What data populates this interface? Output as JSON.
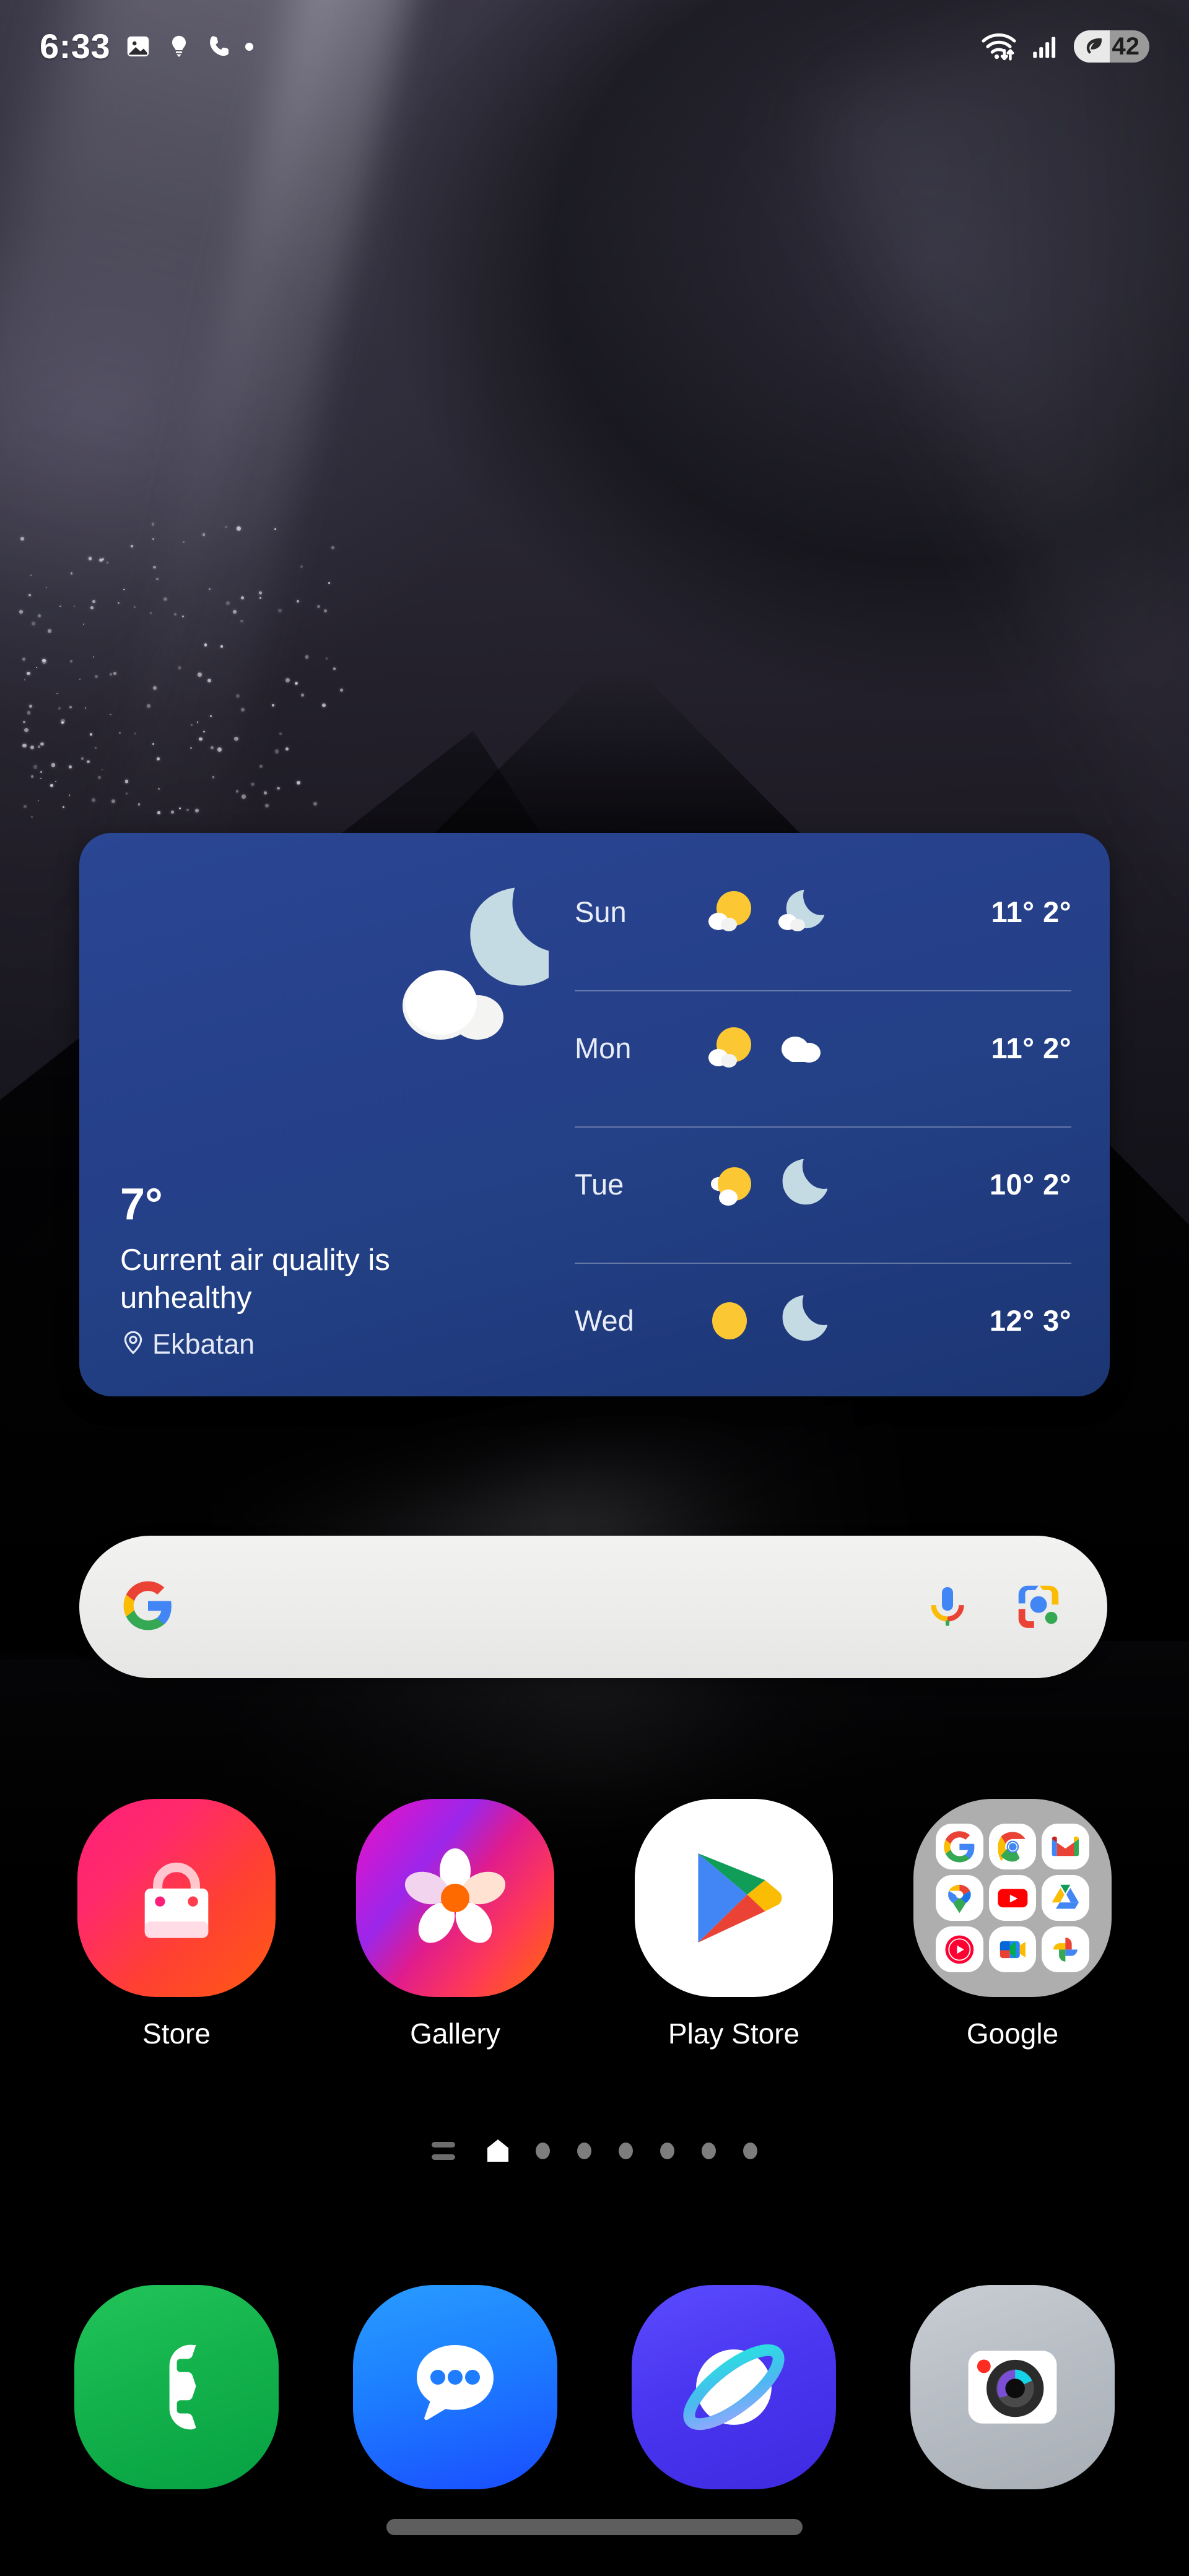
{
  "status_bar": {
    "time": "6:33",
    "left_icons": [
      "image-icon",
      "lightbulb-icon",
      "phone-call-icon",
      "dot-indicator"
    ],
    "right_icons": [
      "wifi-data-icon",
      "cellular-signal-icon"
    ],
    "battery_percent": "42",
    "battery_mode": "power-saving-leaf"
  },
  "weather_widget": {
    "current_temp": "7°",
    "air_quality_text": "Current air quality is unhealthy",
    "location": "Ekbatan",
    "current_condition_icon": "moon-cloud-icon",
    "forecast": [
      {
        "day": "Sun",
        "day_icon": "sun-cloud-icon",
        "night_icon": "moon-cloud-icon",
        "high": "11°",
        "low": "2°"
      },
      {
        "day": "Mon",
        "day_icon": "sun-cloud-icon",
        "night_icon": "cloud-icon",
        "high": "11°",
        "low": "2°"
      },
      {
        "day": "Tue",
        "day_icon": "sun-cloud-icon",
        "night_icon": "moon-icon",
        "high": "10°",
        "low": "2°"
      },
      {
        "day": "Wed",
        "day_icon": "sun-icon",
        "night_icon": "moon-icon",
        "high": "12°",
        "low": "3°"
      }
    ],
    "accent_color": "#25408a"
  },
  "search": {
    "placeholder": "",
    "value": "",
    "logo": "google-g-icon",
    "mic": "microphone-icon",
    "lens": "google-lens-icon"
  },
  "apps": [
    {
      "label": "Store",
      "icon": "galaxy-store-icon"
    },
    {
      "label": "Gallery",
      "icon": "gallery-flower-icon"
    },
    {
      "label": "Play Store",
      "icon": "play-store-icon"
    },
    {
      "label": "Google",
      "icon": "google-folder-icon"
    }
  ],
  "google_folder": {
    "label": "Google",
    "items": [
      "Google",
      "Chrome",
      "Gmail",
      "Maps",
      "YouTube",
      "Drive",
      "YT Music",
      "Meet",
      "Photos"
    ]
  },
  "page_indicator": {
    "pages": 8,
    "current_index": 1,
    "feed_glyph": "hamburger-lines"
  },
  "dock": [
    {
      "label": "Phone",
      "icon": "phone-icon",
      "color": "#11b14b"
    },
    {
      "label": "Messages",
      "icon": "messages-icon",
      "color": "#1d76ff"
    },
    {
      "label": "Internet",
      "icon": "internet-icon",
      "color": "#4a36f0"
    },
    {
      "label": "Camera",
      "icon": "camera-icon",
      "color": "#b9bfc6"
    }
  ],
  "nav": {
    "gesture_pill": true
  }
}
